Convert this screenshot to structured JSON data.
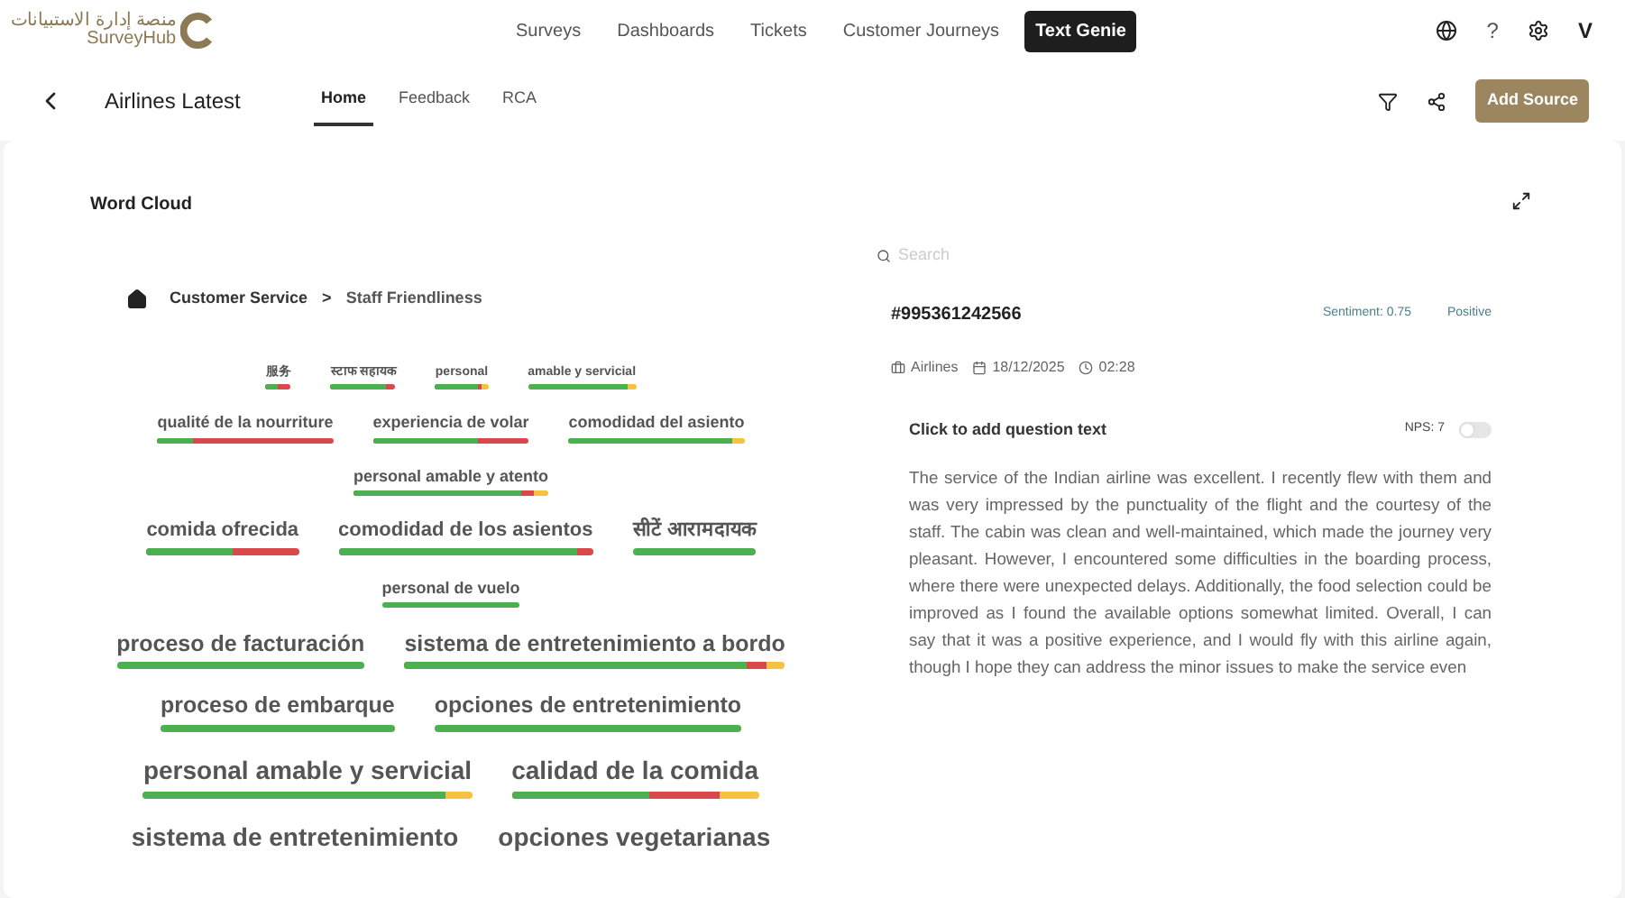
{
  "header": {
    "logo_arabic": "منصة إدارة الاستبيانات",
    "logo_name": "SurveyHub",
    "nav": [
      {
        "label": "Surveys",
        "selected": false
      },
      {
        "label": "Dashboards",
        "selected": false
      },
      {
        "label": "Tickets",
        "selected": false
      },
      {
        "label": "Customer Journeys",
        "selected": false
      },
      {
        "label": "Text Genie",
        "selected": true
      }
    ],
    "help": "?",
    "avatar": "V"
  },
  "subbar": {
    "title": "Airlines Latest",
    "tabs": [
      {
        "label": "Home",
        "selected": true
      },
      {
        "label": "Feedback",
        "selected": false
      },
      {
        "label": "RCA",
        "selected": false
      }
    ],
    "action": "Add Source"
  },
  "word_cloud": {
    "title": "Word Cloud",
    "breadcrumb": [
      "Customer Service",
      "Staff Friendliness"
    ],
    "separator": ">",
    "rows": [
      {
        "words": [
          {
            "text": "服务",
            "kind": "xs",
            "bar": [
              {
                "color": "#d9484b",
                "level": 1
              },
              {
                "color": "#4caf50",
                "level": 0.45
              }
            ]
          },
          {
            "text": "स्टाफ सहायक",
            "kind": "xs",
            "bar": [
              {
                "color": "#d9484b",
                "level": 1
              },
              {
                "color": "#4caf50",
                "level": 0.85
              }
            ]
          },
          {
            "text": "personal",
            "kind": "xs",
            "bar": [
              {
                "color": "#f5c242",
                "level": 1
              },
              {
                "color": "#d9484b",
                "level": 0.87
              },
              {
                "color": "#4caf50",
                "level": 0.8
              }
            ]
          },
          {
            "text": "amable y servicial",
            "kind": "xs",
            "bar": [
              {
                "color": "#f5c242",
                "level": 1
              },
              {
                "color": "#4caf50",
                "level": 0.92
              }
            ]
          }
        ]
      },
      {
        "words": [
          {
            "text": "qualité de la nourriture",
            "kind": "sm",
            "bar": [
              {
                "color": "#d9484b",
                "level": 1
              },
              {
                "color": "#4caf50",
                "level": 0.2
              }
            ]
          },
          {
            "text": "experiencia de volar",
            "kind": "sm",
            "bar": [
              {
                "color": "#d9484b",
                "level": 1
              },
              {
                "color": "#4caf50",
                "level": 0.67
              }
            ]
          },
          {
            "text": "comodidad del asiento",
            "kind": "sm",
            "bar": [
              {
                "color": "#f5c242",
                "level": 1
              },
              {
                "color": "#4caf50",
                "level": 0.93
              }
            ]
          }
        ]
      },
      {
        "words": [
          {
            "text": "personal amable y atento",
            "kind": "sm",
            "bar": [
              {
                "color": "#f5c242",
                "level": 1
              },
              {
                "color": "#d9484b",
                "level": 0.93
              },
              {
                "color": "#4caf50",
                "level": 0.86
              }
            ]
          }
        ]
      },
      {
        "words": [
          {
            "text": "comida ofrecida",
            "kind": "md",
            "bar": [
              {
                "color": "#d9484b",
                "level": 1
              },
              {
                "color": "#4caf50",
                "level": 0.57
              }
            ]
          },
          {
            "text": "comodidad de los asientos",
            "kind": "md",
            "bar": [
              {
                "color": "#d9484b",
                "level": 1
              },
              {
                "color": "#4caf50",
                "level": 0.94
              }
            ]
          },
          {
            "text": "सीटें आरामदायक",
            "kind": "md",
            "bar": [
              {
                "color": "#4caf50",
                "level": 1
              }
            ]
          }
        ]
      },
      {
        "words": [
          {
            "text": "personal de vuelo",
            "kind": "sm",
            "bar": [
              {
                "color": "#4caf50",
                "level": 1
              }
            ]
          }
        ]
      },
      {
        "words": [
          {
            "text": "proceso de facturación",
            "kind": "lg",
            "bar": [
              {
                "color": "#4caf50",
                "level": 1
              }
            ]
          },
          {
            "text": "sistema de entretenimiento a bordo",
            "kind": "lg",
            "bar": [
              {
                "color": "#f5c242",
                "level": 1
              },
              {
                "color": "#d9484b",
                "level": 0.95
              },
              {
                "color": "#4caf50",
                "level": 0.9
              }
            ]
          }
        ]
      },
      {
        "words": [
          {
            "text": "proceso de embarque",
            "kind": "lg",
            "bar": [
              {
                "color": "#4caf50",
                "level": 1
              }
            ]
          },
          {
            "text": "opciones de entretenimiento",
            "kind": "lg",
            "bar": [
              {
                "color": "#4caf50",
                "level": 1
              }
            ]
          }
        ]
      },
      {
        "words": [
          {
            "text": "personal amable y servicial",
            "kind": "xl",
            "bar": [
              {
                "color": "#f5c242",
                "level": 1
              },
              {
                "color": "#4caf50",
                "level": 0.92
              }
            ]
          },
          {
            "text": "calidad de la comida",
            "kind": "xl",
            "bar": [
              {
                "color": "#f5c242",
                "level": 1
              },
              {
                "color": "#d9484b",
                "level": 0.84
              },
              {
                "color": "#4caf50",
                "level": 0.56
              }
            ]
          }
        ]
      },
      {
        "words": [
          {
            "text": "sistema de entretenimiento",
            "kind": "xl"
          },
          {
            "text": "opciones vegetarianas",
            "kind": "xl"
          }
        ]
      }
    ]
  },
  "detail": {
    "search": {
      "placeholder": "Search"
    },
    "id": "#995361242566",
    "sentiment": "Sentiment: 0.75",
    "label": "Positive",
    "category": "Airlines",
    "date": "18/12/2025",
    "time": "02:28",
    "question": "Click to add question text",
    "nps": "NPS: 7",
    "nps_toggle": {
      "on": false
    },
    "review": "The service of the Indian airline was excellent. I recently flew with them and was very impressed by the punctuality of the flight and the courtesy of the staff. The cabin was clean and well-maintained, which made the journey very pleasant. However, I encountered some difficulties in the boarding process, where there were unexpected delays. Additionally, the food selection could be improved as I found the available options somewhat limited. Overall, I can say that it was a positive experience, and I would fly with this airline again, though I hope they can address the minor issues to make the service even"
  }
}
